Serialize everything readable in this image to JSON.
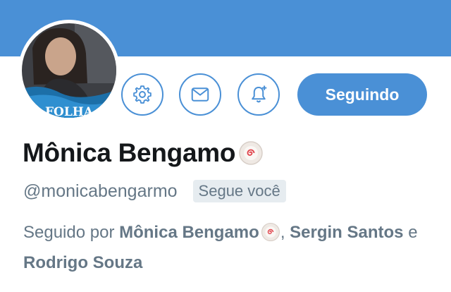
{
  "profile": {
    "display_name": "Mônica Bengamo",
    "handle": "@monicabengarmo",
    "follows_you_label": "Segue você",
    "avatar_logo_text": "FOLHA"
  },
  "actions": {
    "settings_icon": "gear-icon",
    "dm_icon": "envelope-icon",
    "notify_icon": "bell-plus-icon",
    "follow_label": "Seguindo"
  },
  "followed_by": {
    "prefix": "Seguido por",
    "names": [
      "Mônica Bengamo",
      "Sergin Santos",
      "Rodrigo Souza"
    ],
    "separator": ", ",
    "conjunction": "e"
  },
  "colors": {
    "accent": "#4a90d6",
    "text_primary": "#14171a",
    "text_secondary": "#657786",
    "badge_bg": "#e6ecf0"
  }
}
